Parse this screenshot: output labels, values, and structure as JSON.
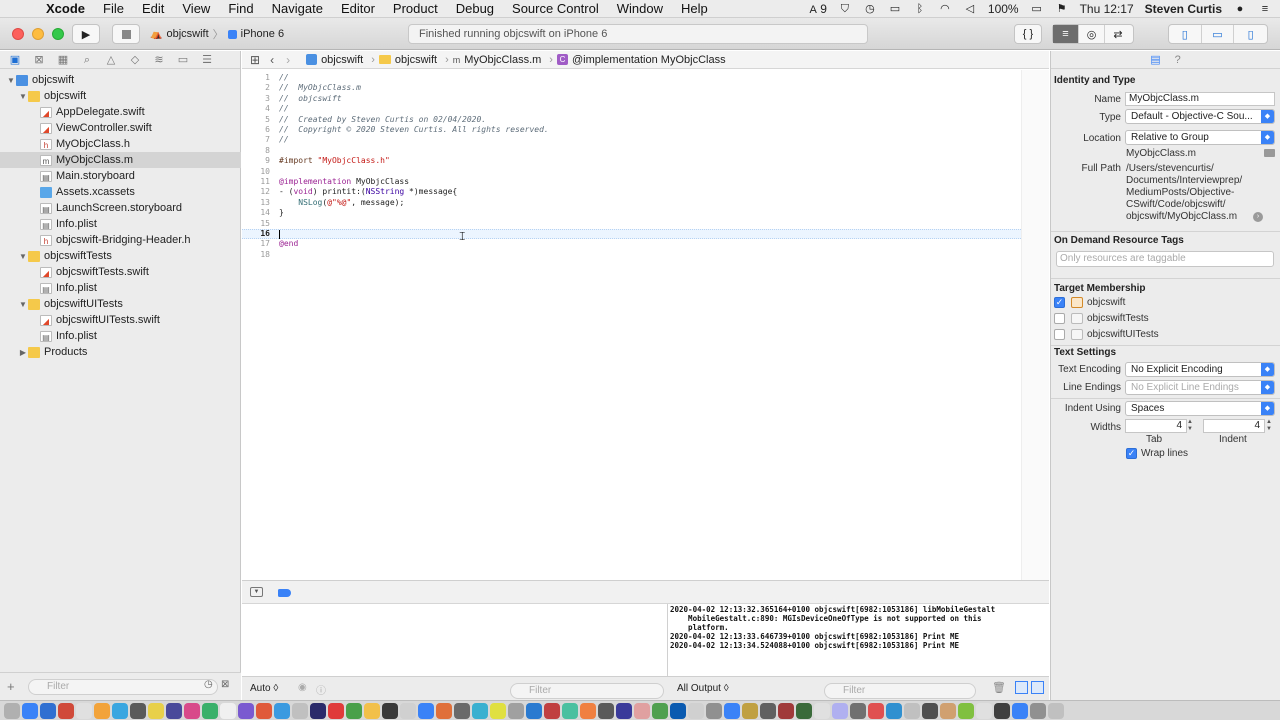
{
  "menubar": {
    "app": "Xcode",
    "items": [
      "File",
      "Edit",
      "View",
      "Find",
      "Navigate",
      "Editor",
      "Product",
      "Debug",
      "Source Control",
      "Window",
      "Help"
    ],
    "status": {
      "adobe": "9",
      "battery": "100%",
      "clock": "Thu 12:17",
      "user": "Steven Curtis"
    }
  },
  "toolbar": {
    "scheme": "objcswift",
    "device": "iPhone 6",
    "activity": "Finished running objcswift on iPhone 6",
    "code_btn": "{ }"
  },
  "navigator": {
    "items": [
      {
        "label": "objcswift",
        "level": 0,
        "icon": "project",
        "disclosure": "open"
      },
      {
        "label": "objcswift",
        "level": 1,
        "icon": "folder",
        "disclosure": "open"
      },
      {
        "label": "AppDelegate.swift",
        "level": 2,
        "icon": "swift"
      },
      {
        "label": "ViewController.swift",
        "level": 2,
        "icon": "swift"
      },
      {
        "label": "MyObjcClass.h",
        "level": 2,
        "icon": "h"
      },
      {
        "label": "MyObjcClass.m",
        "level": 2,
        "icon": "m",
        "selected": true
      },
      {
        "label": "Main.storyboard",
        "level": 2,
        "icon": "storyboard"
      },
      {
        "label": "Assets.xcassets",
        "level": 2,
        "icon": "assets"
      },
      {
        "label": "LaunchScreen.storyboard",
        "level": 2,
        "icon": "storyboard"
      },
      {
        "label": "Info.plist",
        "level": 2,
        "icon": "plist"
      },
      {
        "label": "objcswift-Bridging-Header.h",
        "level": 2,
        "icon": "h"
      },
      {
        "label": "objcswiftTests",
        "level": 1,
        "icon": "folder",
        "disclosure": "open"
      },
      {
        "label": "objcswiftTests.swift",
        "level": 2,
        "icon": "swift"
      },
      {
        "label": "Info.plist",
        "level": 2,
        "icon": "plist"
      },
      {
        "label": "objcswiftUITests",
        "level": 1,
        "icon": "folder",
        "disclosure": "open"
      },
      {
        "label": "objcswiftUITests.swift",
        "level": 2,
        "icon": "swift"
      },
      {
        "label": "Info.plist",
        "level": 2,
        "icon": "plist"
      },
      {
        "label": "Products",
        "level": 1,
        "icon": "folder",
        "disclosure": "closed"
      }
    ],
    "filter_placeholder": "Filter"
  },
  "jumpbar": {
    "crumbs": [
      "objcswift",
      "objcswift",
      "MyObjcClass.m",
      "@implementation MyObjcClass"
    ],
    "c_badge": "C",
    "m_badge": "m"
  },
  "editor": {
    "line_numbers": [
      "1",
      "2",
      "3",
      "4",
      "5",
      "6",
      "7",
      "8",
      "9",
      "10",
      "11",
      "12",
      "13",
      "14",
      "15",
      "16",
      "17",
      "18"
    ],
    "current_line": "16",
    "lines": [
      {
        "t": "//",
        "c": "cm"
      },
      {
        "t": "//  MyObjcClass.m",
        "c": "cm"
      },
      {
        "t": "//  objcswift",
        "c": "cm"
      },
      {
        "t": "//",
        "c": "cm"
      },
      {
        "t": "//  Created by Steven Curtis on 02/04/2020.",
        "c": "cm"
      },
      {
        "t": "//  Copyright © 2020 Steven Curtis. All rights reserved.",
        "c": "cm"
      },
      {
        "t": "//",
        "c": "cm"
      },
      {
        "t": "",
        "c": ""
      },
      {
        "t": "#import \"MyObjcClass.h\"",
        "c": "import"
      },
      {
        "t": "",
        "c": ""
      },
      {
        "t": "@implementation MyObjcClass",
        "c": "impl"
      },
      {
        "t": "- (void) printit:(NSString *)message{",
        "c": "method"
      },
      {
        "t": "    NSLog(@\"%@\", message);",
        "c": "nslog"
      },
      {
        "t": "}",
        "c": ""
      },
      {
        "t": "",
        "c": ""
      },
      {
        "t": "",
        "c": ""
      },
      {
        "t": "@end",
        "c": "kw"
      },
      {
        "t": "",
        "c": ""
      }
    ]
  },
  "debug": {
    "auto_label": "Auto ◊",
    "all_output": "All Output ◊",
    "filter_placeholder": "Filter",
    "console_lines": [
      "2020-04-02 12:13:32.365164+0100 objcswift[6982:1053186] libMobileGestalt",
      "    MobileGestalt.c:890: MGIsDeviceOneOfType is not supported on this",
      "    platform.",
      "2020-04-02 12:13:33.646739+0100 objcswift[6982:1053186] Print ME",
      "2020-04-02 12:13:34.524088+0100 objcswift[6982:1053186] Print ME"
    ]
  },
  "inspector": {
    "identity_title": "Identity and Type",
    "name_label": "Name",
    "name_value": "MyObjcClass.m",
    "type_label": "Type",
    "type_value": "Default - Objective-C Sou...",
    "location_label": "Location",
    "location_value": "Relative to Group",
    "location_file": "MyObjcClass.m",
    "fullpath_label": "Full Path",
    "fullpath_lines": [
      "/Users/stevencurtis/",
      "Documents/Interviewprep/",
      "MediumPosts/Objective-",
      "CSwift/Code/objcswift/",
      "objcswift/MyObjcClass.m"
    ],
    "ondemand_title": "On Demand Resource Tags",
    "tags_placeholder": "Only resources are taggable",
    "target_title": "Target Membership",
    "targets": [
      {
        "label": "objcswift",
        "checked": true
      },
      {
        "label": "objcswiftTests",
        "checked": false
      },
      {
        "label": "objcswiftUITests",
        "checked": false
      }
    ],
    "text_settings_title": "Text Settings",
    "encoding_label": "Text Encoding",
    "encoding_value": "No Explicit Encoding",
    "endings_label": "Line Endings",
    "endings_value": "No Explicit Line Endings",
    "indent_label": "Indent Using",
    "indent_value": "Spaces",
    "widths_label": "Widths",
    "tab_value": "4",
    "indent_width_value": "4",
    "tab_label": "Tab",
    "indent_sub_label": "Indent",
    "wrap_label": "Wrap lines"
  },
  "colors": {
    "accent": "#3a82f7",
    "selection": "#d4d4d4",
    "folder": "#f5c94a"
  }
}
